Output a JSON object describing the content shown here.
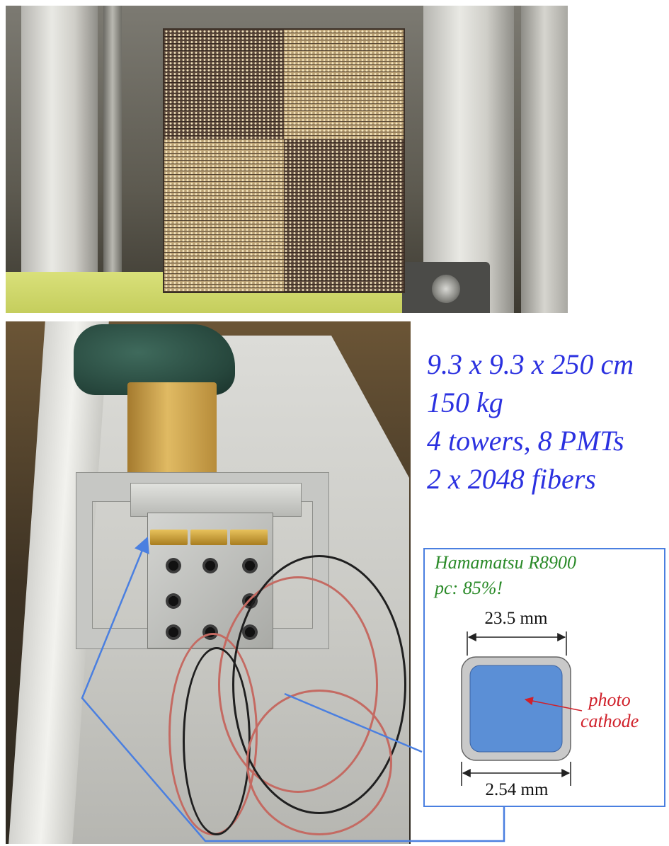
{
  "specs": {
    "dimensions": "9.3 x 9.3 x 250 cm",
    "mass": "150 kg",
    "towers": "4 towers, 8 PMTs",
    "fibers": "2 x 2048 fibers",
    "color": "#2b31e0"
  },
  "inset": {
    "title": "Hamamatsu R8900",
    "pc": "pc: 85%!",
    "width_top": "23.5 mm",
    "width_bottom": "2.54 mm",
    "pc_label_line1": "photo",
    "pc_label_line2": "cathode",
    "border_color": "#4a7fe0",
    "cathode_color": "#5b8fd6",
    "title_color": "#2a8a28",
    "label_color": "#d0202a"
  },
  "photos": {
    "top": "calorimeter-module-photo",
    "bottom": "pmt-readout-photo"
  }
}
